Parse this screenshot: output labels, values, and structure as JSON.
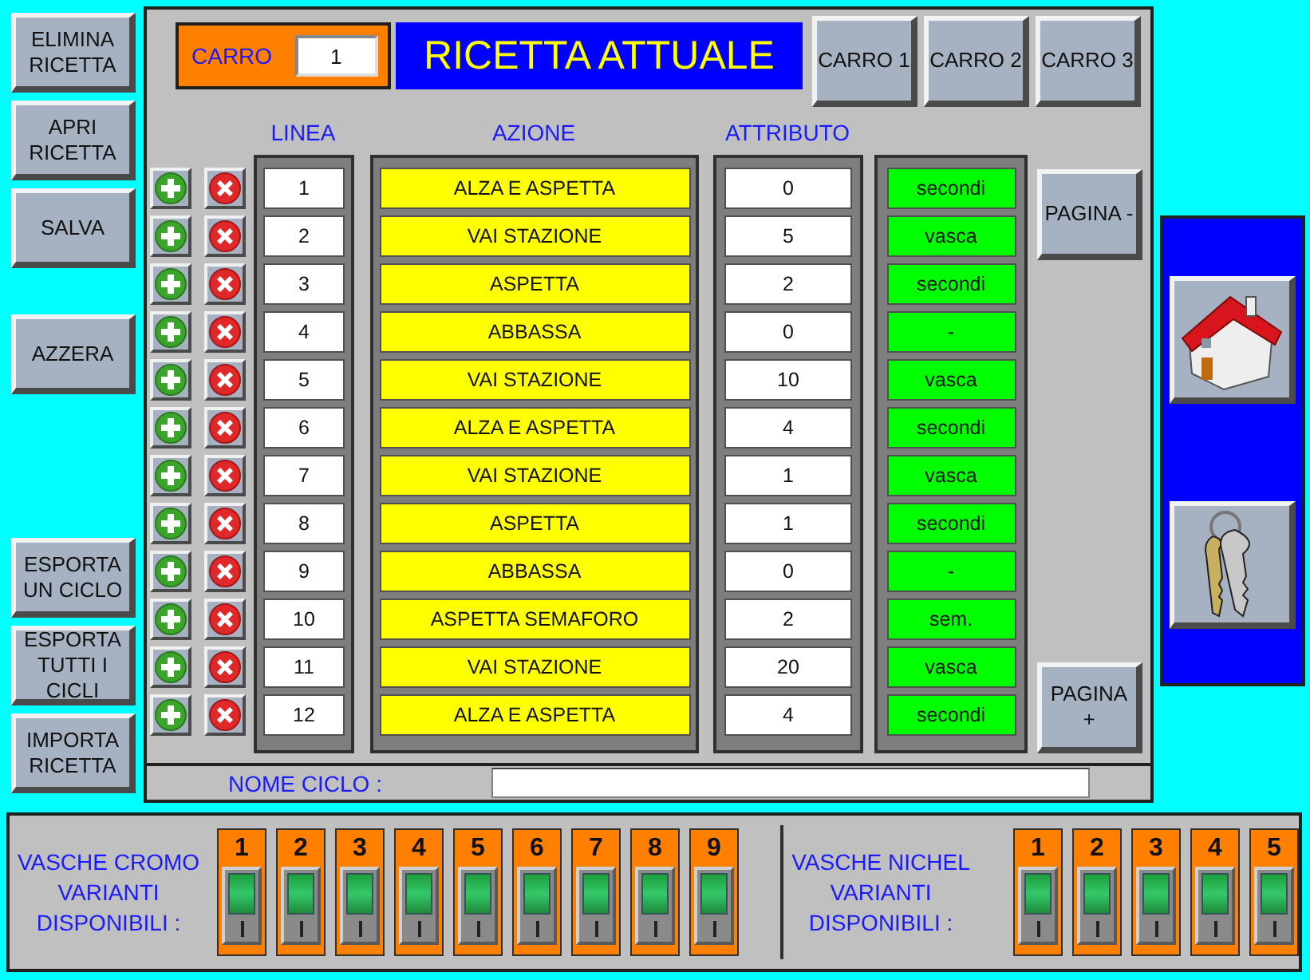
{
  "left_button_groups": [
    {
      "buttons": [
        "ELIMINA\nRICETTA",
        "APRI\nRICETTA",
        "SALVA"
      ]
    },
    {
      "buttons": [
        "AZZERA"
      ]
    },
    {
      "buttons": [
        "ESPORTA\nUN CICLO",
        "ESPORTA\nTUTTI I\nCICLI",
        "IMPORTA\nRICETTA"
      ]
    }
  ],
  "carro": {
    "label": "CARRO",
    "value": "1"
  },
  "title": "RICETTA ATTUALE",
  "carro_buttons": [
    "CARRO 1",
    "CARRO 2",
    "CARRO 3"
  ],
  "columns": [
    "LINEA",
    "AZIONE",
    "ATTRIBUTO"
  ],
  "rows": [
    {
      "linea": "1",
      "azione": "ALZA E ASPETTA",
      "attributo": "0",
      "unita": "secondi"
    },
    {
      "linea": "2",
      "azione": "VAI STAZIONE",
      "attributo": "5",
      "unita": "vasca"
    },
    {
      "linea": "3",
      "azione": "ASPETTA",
      "attributo": "2",
      "unita": "secondi"
    },
    {
      "linea": "4",
      "azione": "ABBASSA",
      "attributo": "0",
      "unita": "-"
    },
    {
      "linea": "5",
      "azione": "VAI STAZIONE",
      "attributo": "10",
      "unita": "vasca"
    },
    {
      "linea": "6",
      "azione": "ALZA E ASPETTA",
      "attributo": "4",
      "unita": "secondi"
    },
    {
      "linea": "7",
      "azione": "VAI STAZIONE",
      "attributo": "1",
      "unita": "vasca"
    },
    {
      "linea": "8",
      "azione": "ASPETTA",
      "attributo": "1",
      "unita": "secondi"
    },
    {
      "linea": "9",
      "azione": "ABBASSA",
      "attributo": "0",
      "unita": "-"
    },
    {
      "linea": "10",
      "azione": "ASPETTA SEMAFORO",
      "attributo": "2",
      "unita": "sem."
    },
    {
      "linea": "11",
      "azione": "VAI STAZIONE",
      "attributo": "20",
      "unita": "vasca"
    },
    {
      "linea": "12",
      "azione": "ALZA E ASPETTA",
      "attributo": "4",
      "unita": "secondi"
    }
  ],
  "page_buttons": [
    "PAGINA -",
    "PAGINA\n+"
  ],
  "nome_ciclo": {
    "label": "NOME CICLO :"
  },
  "tank_groups": [
    {
      "label": "VASCHE CROMO\nVARIANTI\nDISPONIBILI :",
      "tanks": [
        {
          "label": "1",
          "on": true
        },
        {
          "label": "2",
          "on": true
        },
        {
          "label": "3",
          "on": true
        },
        {
          "label": "4",
          "on": true
        },
        {
          "label": "5",
          "on": true
        },
        {
          "label": "6",
          "on": true
        },
        {
          "label": "7",
          "on": true
        },
        {
          "label": "8",
          "on": true
        },
        {
          "label": "9",
          "on": true
        }
      ]
    },
    {
      "label": "VASCHE NICHEL\nVARIANTI\nDISPONIBILI :",
      "tanks": [
        {
          "label": "1",
          "on": true
        },
        {
          "label": "2",
          "on": true
        },
        {
          "label": "3",
          "on": true
        },
        {
          "label": "4",
          "on": true
        },
        {
          "label": "5",
          "on": true
        }
      ]
    }
  ]
}
